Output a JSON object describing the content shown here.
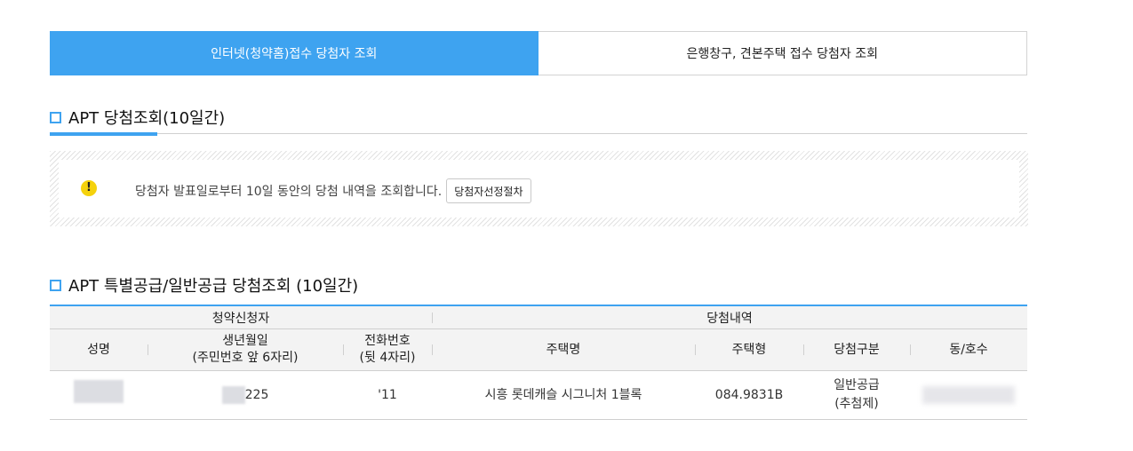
{
  "tabs": [
    {
      "label": "인터넷(청약홈)접수 당첨자 조회",
      "active": true
    },
    {
      "label": "은행창구, 견본주택 접수 당첨자 조회",
      "active": false
    }
  ],
  "section1": {
    "title": "APT 당첨조회(10일간)"
  },
  "notice": {
    "text": "당첨자 발표일로부터 10일 동안의 당첨 내역을 조회합니다.",
    "button_label": "당첨자선정절차",
    "icon": "exclamation-icon",
    "icon_glyph": "!"
  },
  "section2": {
    "title": "APT 특별공급/일반공급 당첨조회 (10일간)"
  },
  "table": {
    "group_headers": {
      "applicant": "청약신청자",
      "winning": "당첨내역"
    },
    "headers": {
      "name": "성명",
      "birth_line1": "생년월일",
      "birth_line2": "(주민번호 앞 6자리)",
      "phone_line1": "전화번호",
      "phone_line2": "(뒷 4자리)",
      "house_name": "주택명",
      "house_type": "주택형",
      "win_type": "당첨구분",
      "unit": "동/호수"
    },
    "rows": [
      {
        "birth_visible": "225",
        "phone_visible": "'11",
        "house_name": "시흥 롯데캐슬 시그니처 1블록",
        "house_type": "084.9831B",
        "win_type_line1": "일반공급",
        "win_type_line2": "(추첨제)"
      }
    ]
  },
  "colors": {
    "accent": "#3ea3f0",
    "warning": "#f5d20c",
    "header_bg": "#f3f3f3"
  }
}
